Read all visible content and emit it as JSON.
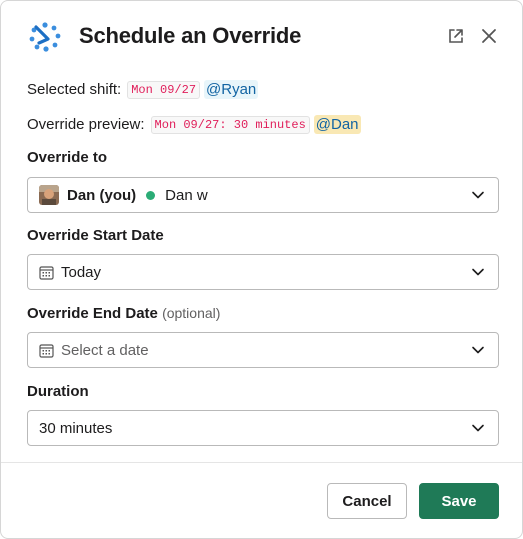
{
  "header": {
    "title": "Schedule an Override",
    "open_icon": "external-link-icon",
    "close_icon": "close-icon",
    "app_icon": "schedule-bot-icon"
  },
  "selected_shift": {
    "label": "Selected shift:",
    "date_code": "Mon 09/27",
    "mention": "@Ryan"
  },
  "override_preview": {
    "label": "Override preview:",
    "code": "Mon 09/27: 30 minutes",
    "mention": "@Dan"
  },
  "fields": {
    "override_to": {
      "label": "Override to",
      "name": "Dan (you)",
      "status_color": "#2bac76",
      "display": "Dan w"
    },
    "start_date": {
      "label": "Override Start Date",
      "value": "Today"
    },
    "end_date": {
      "label": "Override End Date",
      "optional": "(optional)",
      "placeholder": "Select a date"
    },
    "duration": {
      "label": "Duration",
      "value": "30 minutes"
    }
  },
  "footer": {
    "cancel_label": "Cancel",
    "save_label": "Save",
    "save_color": "#1f7a57"
  }
}
